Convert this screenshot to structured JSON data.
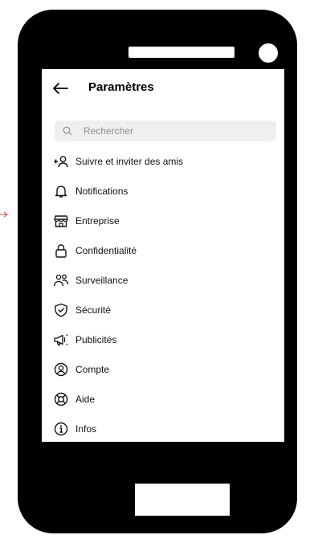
{
  "header": {
    "title": "Paramètres"
  },
  "search": {
    "placeholder": "Rechercher"
  },
  "menu": [
    {
      "icon": "add-person-icon",
      "label": "Suivre et inviter des amis"
    },
    {
      "icon": "bell-icon",
      "label": "Notifications"
    },
    {
      "icon": "store-icon",
      "label": "Entreprise"
    },
    {
      "icon": "lock-icon",
      "label": "Confidentialité"
    },
    {
      "icon": "supervision-icon",
      "label": "Surveillance"
    },
    {
      "icon": "shield-check-icon",
      "label": "Sécurité"
    },
    {
      "icon": "megaphone-icon",
      "label": "Publicités"
    },
    {
      "icon": "account-circle-icon",
      "label": "Compte"
    },
    {
      "icon": "lifebuoy-icon",
      "label": "Aide"
    },
    {
      "icon": "info-icon",
      "label": "Infos"
    }
  ],
  "colors": {
    "phone": "#000000",
    "arrow": "#d64545",
    "search_bg": "#efefef"
  }
}
